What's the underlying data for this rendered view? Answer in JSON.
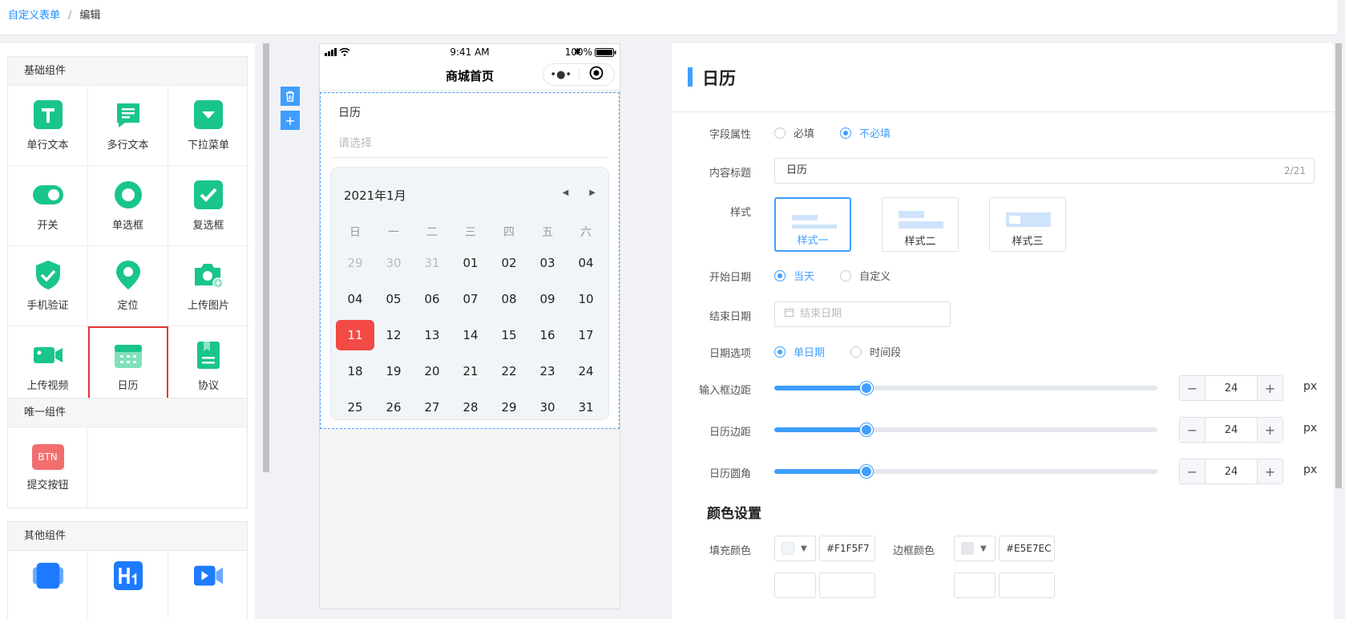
{
  "breadcrumb": {
    "parent": "自定义表单",
    "separator": "/",
    "current": "编辑"
  },
  "components": {
    "basic": {
      "title": "基础组件",
      "items": [
        {
          "label": "单行文本",
          "icon": "text-t-icon"
        },
        {
          "label": "多行文本",
          "icon": "multiline-text-icon"
        },
        {
          "label": "下拉菜单",
          "icon": "dropdown-icon"
        },
        {
          "label": "开关",
          "icon": "toggle-icon"
        },
        {
          "label": "单选框",
          "icon": "radio-icon"
        },
        {
          "label": "复选框",
          "icon": "checkbox-icon"
        },
        {
          "label": "手机验证",
          "icon": "shield-check-icon"
        },
        {
          "label": "定位",
          "icon": "location-pin-icon"
        },
        {
          "label": "上传图片",
          "icon": "camera-icon"
        },
        {
          "label": "上传视频",
          "icon": "video-icon"
        },
        {
          "label": "日历",
          "icon": "calendar-icon"
        },
        {
          "label": "协议",
          "icon": "document-icon"
        }
      ]
    },
    "unique": {
      "title": "唯一组件",
      "items": [
        {
          "label": "提交按钮",
          "icon": "btn-icon",
          "icon_text": "BTN"
        }
      ]
    },
    "other": {
      "title": "其他组件"
    }
  },
  "phone": {
    "time": "9:41 AM",
    "battery": "100%",
    "page_title": "商城首页",
    "field_label": "日历",
    "field_placeholder": "请选择",
    "calendar": {
      "month_title": "2021年1月",
      "weekdays": [
        "日",
        "一",
        "二",
        "三",
        "四",
        "五",
        "六"
      ],
      "days": [
        {
          "d": "29",
          "m": true
        },
        {
          "d": "30",
          "m": true
        },
        {
          "d": "31",
          "m": true
        },
        {
          "d": "01"
        },
        {
          "d": "02"
        },
        {
          "d": "03"
        },
        {
          "d": "04"
        },
        {
          "d": "04"
        },
        {
          "d": "05"
        },
        {
          "d": "06"
        },
        {
          "d": "07"
        },
        {
          "d": "08"
        },
        {
          "d": "09"
        },
        {
          "d": "10"
        },
        {
          "d": "11",
          "s": true
        },
        {
          "d": "12"
        },
        {
          "d": "13"
        },
        {
          "d": "14"
        },
        {
          "d": "15"
        },
        {
          "d": "16"
        },
        {
          "d": "17"
        },
        {
          "d": "18"
        },
        {
          "d": "19"
        },
        {
          "d": "20"
        },
        {
          "d": "21"
        },
        {
          "d": "22"
        },
        {
          "d": "23"
        },
        {
          "d": "24"
        },
        {
          "d": "25"
        },
        {
          "d": "26"
        },
        {
          "d": "27"
        },
        {
          "d": "28"
        },
        {
          "d": "29"
        },
        {
          "d": "30"
        },
        {
          "d": "31"
        }
      ]
    }
  },
  "settings": {
    "title": "日历",
    "field_attr": {
      "label": "字段属性",
      "opt_required": "必填",
      "opt_optional": "不必填"
    },
    "content_title": {
      "label": "内容标题",
      "value": "日历",
      "count": "2/21"
    },
    "style": {
      "label": "样式",
      "opt1": "样式一",
      "opt2": "样式二",
      "opt3": "样式三"
    },
    "start_date": {
      "label": "开始日期",
      "opt_today": "当天",
      "opt_custom": "自定义"
    },
    "end_date": {
      "label": "结束日期",
      "placeholder": "结束日期"
    },
    "date_option": {
      "label": "日期选项",
      "opt_single": "单日期",
      "opt_range": "时间段"
    },
    "input_margin": {
      "label": "输入框边距",
      "value": "24",
      "unit": "px",
      "level": 0.24
    },
    "calendar_margin": {
      "label": "日历边距",
      "value": "24",
      "unit": "px",
      "level": 0.24
    },
    "calendar_radius": {
      "label": "日历圆角",
      "value": "24",
      "unit": "px",
      "level": 0.24
    },
    "color_section": "颜色设置",
    "fill_color": {
      "label": "填充颜色",
      "value": "#F1F5F7"
    },
    "border_color": {
      "label": "边框颜色",
      "value": "#E5E7EC"
    }
  },
  "colors": {
    "accent": "#409eff",
    "icon_green": "#19c58a",
    "selected_day": "#f24a45",
    "highlight_border": "#e53935"
  }
}
